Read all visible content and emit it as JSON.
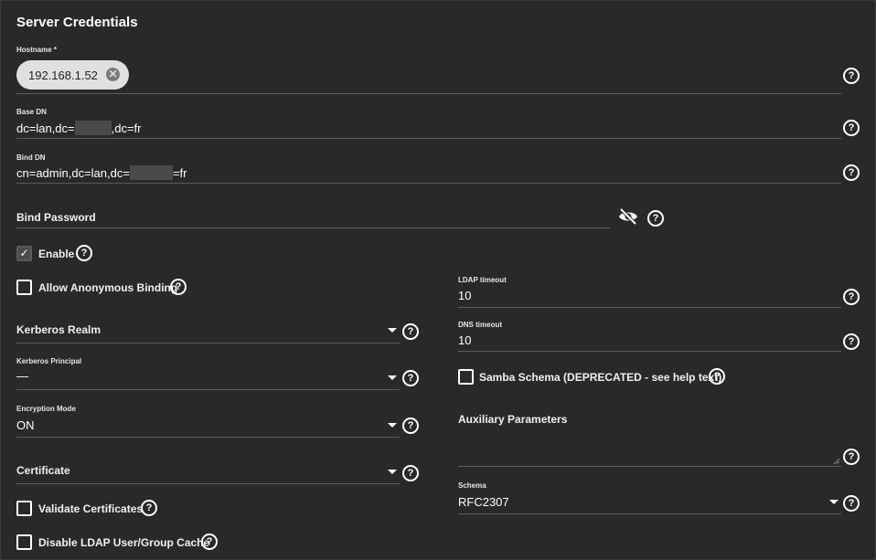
{
  "section": {
    "title": "Server Credentials"
  },
  "hostname": {
    "label": "Hostname *",
    "chip_value": "192.168.1.52",
    "remove_glyph": "✕"
  },
  "base_dn": {
    "label": "Base DN",
    "value_prefix": "dc=lan,dc=",
    "value_suffix": ",dc=fr"
  },
  "bind_dn": {
    "label": "Bind DN",
    "value_prefix": "cn=admin,dc=lan,dc=",
    "value_suffix": "=fr"
  },
  "bind_password": {
    "label": "Bind Password"
  },
  "enable": {
    "label": "Enable",
    "checked": true
  },
  "allow_anonymous": {
    "label": "Allow Anonymous Binding",
    "checked": false
  },
  "kerberos_realm": {
    "label": "Kerberos Realm"
  },
  "kerberos_principal": {
    "label": "Kerberos Principal",
    "value": "—"
  },
  "encryption_mode": {
    "label": "Encryption Mode",
    "value": "ON"
  },
  "certificate": {
    "label": "Certificate"
  },
  "validate_certificates": {
    "label": "Validate Certificates",
    "checked": false
  },
  "disable_cache": {
    "label": "Disable LDAP User/Group Cache",
    "checked": false
  },
  "ldap_timeout": {
    "label": "LDAP timeout",
    "value": "10"
  },
  "dns_timeout": {
    "label": "DNS timeout",
    "value": "10"
  },
  "samba_schema": {
    "label": "Samba Schema (DEPRECATED - see help text)",
    "checked": false
  },
  "auxiliary_parameters": {
    "label": "Auxiliary Parameters",
    "value": ""
  },
  "schema": {
    "label": "Schema",
    "value": "RFC2307"
  },
  "help_glyph": "?",
  "check_glyph": "✓",
  "icons": {
    "help": "help-circle-icon",
    "dropdown": "caret-down-icon",
    "visibility": "eye-off-icon",
    "remove": "cancel-circle-icon"
  },
  "colors": {
    "background": "#292929",
    "chip": "#e0e0e0",
    "underline": "#5b5b5b"
  }
}
